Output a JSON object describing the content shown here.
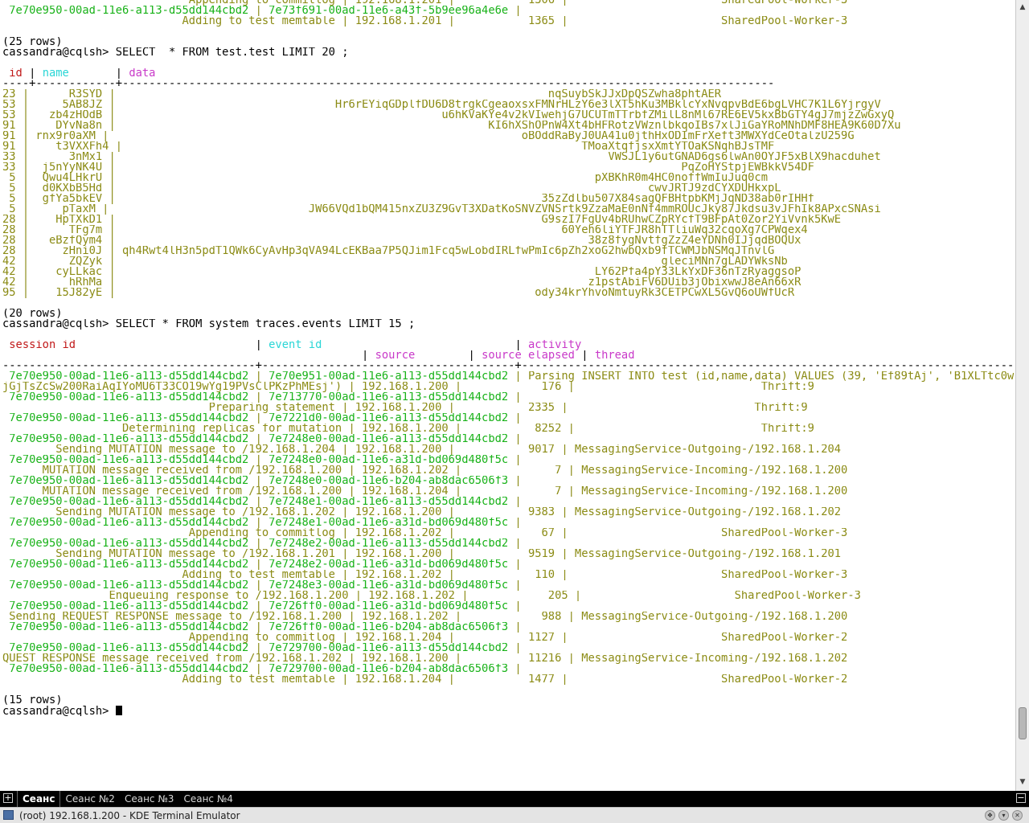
{
  "window": {
    "title": "(root) 192.168.1.200 - KDE Terminal Emulator",
    "controls": [
      "❖",
      "▾",
      "✕"
    ]
  },
  "tabbar": {
    "new_tab_symbol": "+",
    "close_tab_symbol": "−",
    "tabs": [
      {
        "label": "Сеанс",
        "active": true
      },
      {
        "label": "Сеанс №2",
        "active": false
      },
      {
        "label": "Сеанс №3",
        "active": false
      },
      {
        "label": "Сеанс №4",
        "active": false
      }
    ]
  },
  "scrollbar": {
    "up_symbol": "▲",
    "down_symbol": "▼"
  },
  "colors": {
    "uuid": "#18b218",
    "text": "#8b8b14",
    "header_red": "#c11a1a",
    "header_cyan": "#2ad6d6",
    "header_magenta": "#c93ac9"
  },
  "terminal": {
    "lines": [
      [
        {
          "t": "                            Appending to commitlog | 192.168.1.201 |           1306 |                       SharedPool-Worker-3",
          "c": "y"
        }
      ],
      [
        {
          "t": " 7e70e950-00ad-11e6-a113-d55dd144cbd2",
          "c": "g"
        },
        {
          "t": " | ",
          "c": "y"
        },
        {
          "t": "7e73f691-00ad-11e6-a43f-5b9ee96a4e6e",
          "c": "g"
        },
        {
          "t": " |",
          "c": "y"
        }
      ],
      [
        {
          "t": "                           Adding to test memtable | 192.168.1.201 |           1365 |                       SharedPool-Worker-3",
          "c": "y"
        }
      ],
      [
        {
          "t": "",
          "c": "w"
        }
      ],
      [
        {
          "t": "(25 rows)",
          "c": "w"
        }
      ],
      [
        {
          "t": "cassandra@cqlsh> SELECT  * FROM test.test LIMIT 20 ;",
          "c": "w"
        }
      ],
      [
        {
          "t": "",
          "c": "w"
        }
      ],
      [
        {
          "t": " ",
          "c": "w"
        },
        {
          "t": "id",
          "c": "r"
        },
        {
          "t": " | ",
          "c": "w"
        },
        {
          "t": "name",
          "c": "c"
        },
        {
          "t": "       | ",
          "c": "w"
        },
        {
          "t": "data",
          "c": "m"
        }
      ],
      [
        {
          "t": "----+------------+--------------------------------------------------------------------------------------------------",
          "c": "w"
        }
      ],
      [
        {
          "t": "23 |      R3SYD |                                                                 nqSuybSkJJxDpQSZwha8phtAER",
          "c": "y"
        }
      ],
      [
        {
          "t": "53 |     5AB8JZ |                                 Hr6rEYiqGDplfDU6D8trgkCgeaoxsxFMNrHLzY6e3lXT5hKu3MBklcYxNvqpvBdE6bgLVHC7K1L6YjrgyV",
          "c": "y"
        }
      ],
      [
        {
          "t": "53 |   zb4zHOdB |                                                 u6hKVaKYe4v2kVIwehjG7UCUTmTTrbfZMilL8nMl67RE6EV5kxBbGTY4gJ7mjzZwGxyQ",
          "c": "y"
        }
      ],
      [
        {
          "t": "91 |    DYvNa8n |                                                        KI6hXShOPnW4Xt4bHFRotzVWznlbkqoIBs7xlJiGaYRoMNhDMF8HEA9K60D7Xu",
          "c": "y"
        }
      ],
      [
        {
          "t": "91 | rnx9r0aXM |                                                              oBOddRaByJ0UA41u0jthHxODImFrXeft3MWXYdCeOtalzU259G",
          "c": "y"
        }
      ],
      [
        {
          "t": "91 |    t3VXXFh4 |                                                                     TMoaXtqfjsxXmtYTOaKSNqhBJsTMF",
          "c": "y"
        }
      ],
      [
        {
          "t": "33 |      3nMx1 |                                                                          VWSJL1y6utGNAD6gs6lwAn0OYJF5xBlX9hacduhet",
          "c": "y"
        }
      ],
      [
        {
          "t": "33 |  j5nYyNK4U |                                                                                     PqZoHYStpjEWBkkV54DF",
          "c": "y"
        }
      ],
      [
        {
          "t": " 5 |  Qwu4LHkrU |                                                                        pXBKhR0m4HC0noffWmIuJuq0cm",
          "c": "y"
        }
      ],
      [
        {
          "t": " 5 |  d0KXbB5Hd |                                                                                cwvJRTJ9zdCYXDUHkxpL",
          "c": "y"
        }
      ],
      [
        {
          "t": " 5 |  gfYa5bkEV |                                                                35zZdlbu507X84sagQFBHtpbKMjJqND38ab0rIHHf",
          "c": "y"
        }
      ],
      [
        {
          "t": " 5 |     pTaxM |                              JW66VQd1bQM415nxZU3Z9GvT3XDatKoSNVZVNSrtk9ZzaMaE0nNf4mmROUcJky87Jkdsu3vJFhIk8APxcSNAsi",
          "c": "y"
        }
      ],
      [
        {
          "t": "28 |    HpTXkD1 |                                                                G9szI7FgUv4bRUhwCZpRYcfT9BFpAt0Zor2YiVvnk5KwE",
          "c": "y"
        }
      ],
      [
        {
          "t": "28 |      TFg7m |                                                                   60Yeh6liYTFJR8hTTliuWq32cqoXg7CPWqex4",
          "c": "y"
        }
      ],
      [
        {
          "t": "28 |   eBzfQym4 |                                                                       38z8fygNvtfgZzZ4eYDNh0IJjqdBOQUx",
          "c": "y"
        }
      ],
      [
        {
          "t": "28 |     zHni0J | qh4Rwt4lH3n5pdT1QWk6CyAvHp3qVA94LcEKBaa7P5QJim1Fcq5wLobdIRLfwPmIc6pZh2xoG2hwbQxb9fTCWMJbNSMqJTnvlG",
          "c": "y"
        }
      ],
      [
        {
          "t": "42 |      ZQZyk |                                                                                  gleciMNn7gLADYWksNb",
          "c": "y"
        }
      ],
      [
        {
          "t": "42 |    cyLLkac |                                                                        LY62Pfa4pY33LkYxDF36nTzRyaggsoP",
          "c": "y"
        }
      ],
      [
        {
          "t": "42 |      hRhMa |                                                                       z1pstAbiFV6DUib3jObixwwJ8eAn66xR",
          "c": "y"
        }
      ],
      [
        {
          "t": "95 |    15J82yE |                                                               ody34krYhvoNmtuyRk3CETPCwXL5GvQ6oUWfUcR",
          "c": "y"
        }
      ],
      [
        {
          "t": "",
          "c": "w"
        }
      ],
      [
        {
          "t": "(20 rows)",
          "c": "w"
        }
      ],
      [
        {
          "t": "cassandra@cqlsh> SELECT * FROM system_traces.events LIMIT 15 ;",
          "c": "w"
        }
      ],
      [
        {
          "t": "",
          "c": "w"
        }
      ],
      [
        {
          "t": " ",
          "c": "w"
        },
        {
          "t": "session_id",
          "c": "r"
        },
        {
          "t": "                           | ",
          "c": "w"
        },
        {
          "t": "event_id",
          "c": "c"
        },
        {
          "t": "                             | ",
          "c": "w"
        },
        {
          "t": "activity",
          "c": "m"
        }
      ],
      [
        {
          "t": "                                                      | ",
          "c": "w"
        },
        {
          "t": "source",
          "c": "m"
        },
        {
          "t": "        | ",
          "c": "w"
        },
        {
          "t": "source_elapsed",
          "c": "m"
        },
        {
          "t": " | ",
          "c": "w"
        },
        {
          "t": "thread",
          "c": "m"
        }
      ],
      [
        {
          "t": "--------------------------------------+--------------------------------------+--------------------------------------------------------------------------------------------------------------------",
          "c": "w"
        }
      ],
      [
        {
          "t": " 7e70e950-00ad-11e6-a113-d55dd144cbd2",
          "c": "g"
        },
        {
          "t": " | ",
          "c": "y"
        },
        {
          "t": "7e70e951-00ad-11e6-a113-d55dd144cbd2",
          "c": "g"
        },
        {
          "t": " | Parsing INSERT INTO test (id,name,data) VALUES (39, 'Ef89tAj', 'B1XLTtc0wYvAJO",
          "c": "y"
        }
      ],
      [
        {
          "t": "jGjTsZcSw200RaiAqIYoMU6T33CO19wYg19PVsClPKzPhMEsj') | 192.168.1.200 |            176 |                            Thrift:9",
          "c": "y"
        }
      ],
      [
        {
          "t": " 7e70e950-00ad-11e6-a113-d55dd144cbd2",
          "c": "g"
        },
        {
          "t": " | ",
          "c": "y"
        },
        {
          "t": "7e713770-00ad-11e6-a113-d55dd144cbd2",
          "c": "g"
        },
        {
          "t": " |",
          "c": "y"
        }
      ],
      [
        {
          "t": "                               Preparing statement | 192.168.1.200 |           2335 |                            Thrift:9",
          "c": "y"
        }
      ],
      [
        {
          "t": " 7e70e950-00ad-11e6-a113-d55dd144cbd2",
          "c": "g"
        },
        {
          "t": " | ",
          "c": "y"
        },
        {
          "t": "7e7221d0-00ad-11e6-a113-d55dd144cbd2",
          "c": "g"
        },
        {
          "t": " |",
          "c": "y"
        }
      ],
      [
        {
          "t": "                  Determining replicas for mutation | 192.168.1.200 |           8252 |                            Thrift:9",
          "c": "y"
        }
      ],
      [
        {
          "t": " 7e70e950-00ad-11e6-a113-d55dd144cbd2",
          "c": "g"
        },
        {
          "t": " | ",
          "c": "y"
        },
        {
          "t": "7e7248e0-00ad-11e6-a113-d55dd144cbd2",
          "c": "g"
        },
        {
          "t": " |",
          "c": "y"
        }
      ],
      [
        {
          "t": "        Sending MUTATION message to /192.168.1.204 | 192.168.1.200 |           9017 | MessagingService-Outgoing-/192.168.1.204",
          "c": "y"
        }
      ],
      [
        {
          "t": " 7e70e950-00ad-11e6-a113-d55dd144cbd2",
          "c": "g"
        },
        {
          "t": " | ",
          "c": "y"
        },
        {
          "t": "7e7248e0-00ad-11e6-a31d-bd069d480f5c",
          "c": "g"
        },
        {
          "t": " |",
          "c": "y"
        }
      ],
      [
        {
          "t": "      MUTATION message received from /192.168.1.200 | 192.168.1.202 |              7 | MessagingService-Incoming-/192.168.1.200",
          "c": "y"
        }
      ],
      [
        {
          "t": " 7e70e950-00ad-11e6-a113-d55dd144cbd2",
          "c": "g"
        },
        {
          "t": " | ",
          "c": "y"
        },
        {
          "t": "7e7248e0-00ad-11e6-b204-ab8dac6506f3",
          "c": "g"
        },
        {
          "t": " |",
          "c": "y"
        }
      ],
      [
        {
          "t": "      MUTATION message received from /192.168.1.200 | 192.168.1.204 |              7 | MessagingService-Incoming-/192.168.1.200",
          "c": "y"
        }
      ],
      [
        {
          "t": " 7e70e950-00ad-11e6-a113-d55dd144cbd2",
          "c": "g"
        },
        {
          "t": " | ",
          "c": "y"
        },
        {
          "t": "7e7248e1-00ad-11e6-a113-d55dd144cbd2",
          "c": "g"
        },
        {
          "t": " |",
          "c": "y"
        }
      ],
      [
        {
          "t": "        Sending MUTATION message to /192.168.1.202 | 192.168.1.200 |           9383 | MessagingService-Outgoing-/192.168.1.202",
          "c": "y"
        }
      ],
      [
        {
          "t": " 7e70e950-00ad-11e6-a113-d55dd144cbd2",
          "c": "g"
        },
        {
          "t": " | ",
          "c": "y"
        },
        {
          "t": "7e7248e1-00ad-11e6-a31d-bd069d480f5c",
          "c": "g"
        },
        {
          "t": " |",
          "c": "y"
        }
      ],
      [
        {
          "t": "                            Appending to commitlog | 192.168.1.202 |             67 |                       SharedPool-Worker-3",
          "c": "y"
        }
      ],
      [
        {
          "t": " 7e70e950-00ad-11e6-a113-d55dd144cbd2",
          "c": "g"
        },
        {
          "t": " | ",
          "c": "y"
        },
        {
          "t": "7e7248e2-00ad-11e6-a113-d55dd144cbd2",
          "c": "g"
        },
        {
          "t": " |",
          "c": "y"
        }
      ],
      [
        {
          "t": "        Sending MUTATION message to /192.168.1.201 | 192.168.1.200 |           9519 | MessagingService-Outgoing-/192.168.1.201",
          "c": "y"
        }
      ],
      [
        {
          "t": " 7e70e950-00ad-11e6-a113-d55dd144cbd2",
          "c": "g"
        },
        {
          "t": " | ",
          "c": "y"
        },
        {
          "t": "7e7248e2-00ad-11e6-a31d-bd069d480f5c",
          "c": "g"
        },
        {
          "t": " |",
          "c": "y"
        }
      ],
      [
        {
          "t": "                           Adding to test memtable | 192.168.1.202 |            110 |                       SharedPool-Worker-3",
          "c": "y"
        }
      ],
      [
        {
          "t": " 7e70e950-00ad-11e6-a113-d55dd144cbd2",
          "c": "g"
        },
        {
          "t": " | ",
          "c": "y"
        },
        {
          "t": "7e7248e3-00ad-11e6-a31d-bd069d480f5c",
          "c": "g"
        },
        {
          "t": " |",
          "c": "y"
        }
      ],
      [
        {
          "t": "                Enqueuing response to /192.168.1.200 | 192.168.1.202 |            205 |                       SharedPool-Worker-3",
          "c": "y"
        }
      ],
      [
        {
          "t": " 7e70e950-00ad-11e6-a113-d55dd144cbd2",
          "c": "g"
        },
        {
          "t": " | ",
          "c": "y"
        },
        {
          "t": "7e726ff0-00ad-11e6-a31d-bd069d480f5c",
          "c": "g"
        },
        {
          "t": " |",
          "c": "y"
        }
      ],
      [
        {
          "t": " Sending REQUEST_RESPONSE message to /192.168.1.200 | 192.168.1.202 |            988 | MessagingService-Outgoing-/192.168.1.200",
          "c": "y"
        }
      ],
      [
        {
          "t": " 7e70e950-00ad-11e6-a113-d55dd144cbd2",
          "c": "g"
        },
        {
          "t": " | ",
          "c": "y"
        },
        {
          "t": "7e726ff0-00ad-11e6-b204-ab8dac6506f3",
          "c": "g"
        },
        {
          "t": " |",
          "c": "y"
        }
      ],
      [
        {
          "t": "                            Appending to commitlog | 192.168.1.204 |           1127 |                       SharedPool-Worker-2",
          "c": "y"
        }
      ],
      [
        {
          "t": " 7e70e950-00ad-11e6-a113-d55dd144cbd2",
          "c": "g"
        },
        {
          "t": " | ",
          "c": "y"
        },
        {
          "t": "7e729700-00ad-11e6-a113-d55dd144cbd2",
          "c": "g"
        },
        {
          "t": " |                                                                                    RE",
          "c": "y"
        }
      ],
      [
        {
          "t": "QUEST_RESPONSE message received from /192.168.1.202 | 192.168.1.200 |          11216 | MessagingService-Incoming-/192.168.1.202",
          "c": "y"
        }
      ],
      [
        {
          "t": " 7e70e950-00ad-11e6-a113-d55dd144cbd2",
          "c": "g"
        },
        {
          "t": " | ",
          "c": "y"
        },
        {
          "t": "7e729700-00ad-11e6-b204-ab8dac6506f3",
          "c": "g"
        },
        {
          "t": " |",
          "c": "y"
        }
      ],
      [
        {
          "t": "                           Adding to test memtable | 192.168.1.204 |           1477 |                       SharedPool-Worker-2",
          "c": "y"
        }
      ],
      [
        {
          "t": "",
          "c": "w"
        }
      ],
      [
        {
          "t": "(15 rows)",
          "c": "w"
        }
      ],
      [
        {
          "t": "cassandra@cqlsh> ",
          "c": "w"
        }
      ]
    ]
  }
}
